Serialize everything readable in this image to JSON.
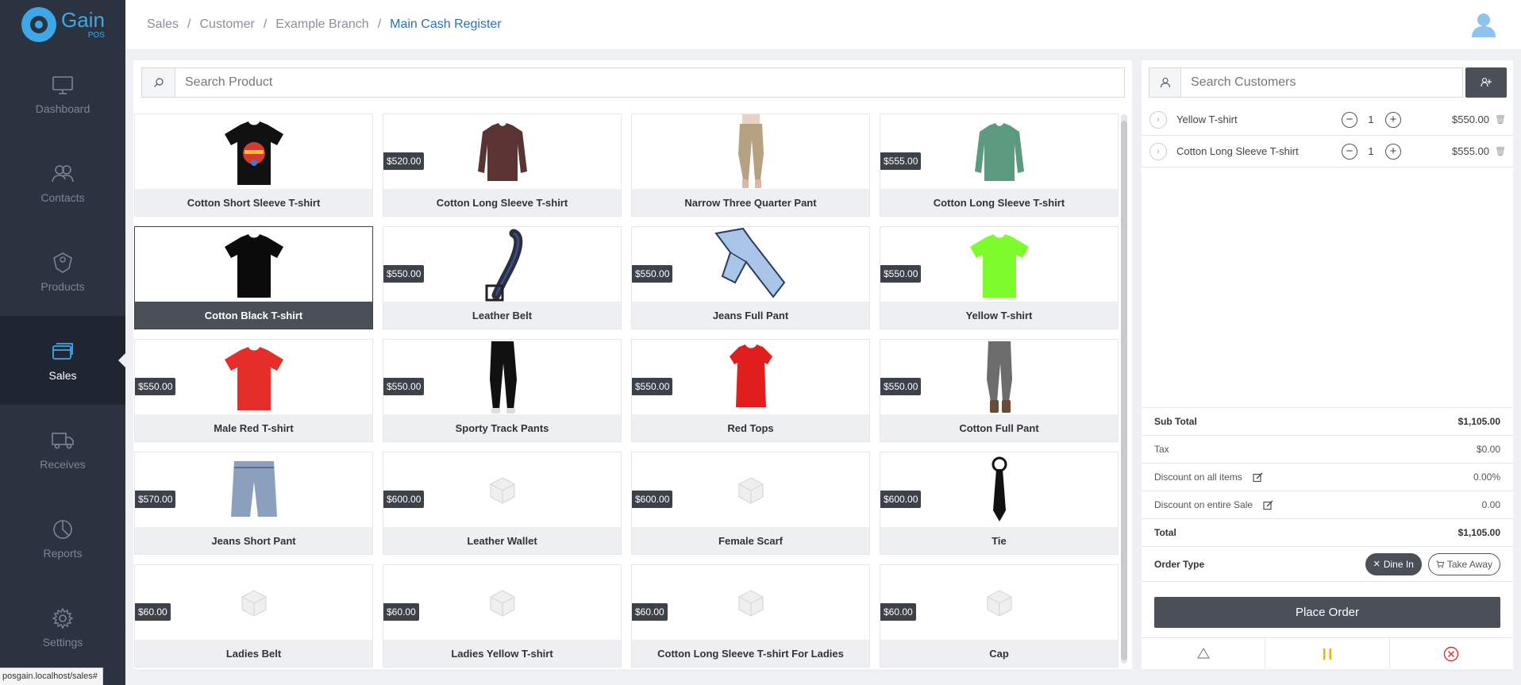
{
  "app": {
    "name": "Gain",
    "sub": "POS"
  },
  "nav": [
    {
      "label": "Dashboard",
      "icon": "monitor-icon"
    },
    {
      "label": "Contacts",
      "icon": "users-icon"
    },
    {
      "label": "Products",
      "icon": "cube-icon"
    },
    {
      "label": "Sales",
      "icon": "cards-icon",
      "active": true
    },
    {
      "label": "Receives",
      "icon": "truck-icon"
    },
    {
      "label": "Reports",
      "icon": "pie-chart-icon"
    },
    {
      "label": "Settings",
      "icon": "gear-icon"
    }
  ],
  "breadcrumb": [
    "Sales",
    "Customer",
    "Example Branch",
    "Main Cash Register"
  ],
  "search": {
    "placeholder": "Search Product"
  },
  "products": [
    {
      "name": "Cotton Short Sleeve T-shirt",
      "price": "",
      "img": "black-tshirt-print"
    },
    {
      "name": "Cotton Long Sleeve T-shirt",
      "price": "$520.00",
      "img": "longsleeve-maroon"
    },
    {
      "name": "Narrow Three Quarter Pant",
      "price": "",
      "img": "pants-beige"
    },
    {
      "name": "Cotton Long Sleeve T-shirt",
      "price": "$555.00",
      "img": "longsleeve-green"
    },
    {
      "name": "Cotton Black T-shirt",
      "price": "",
      "img": "tshirt-black",
      "selected": true
    },
    {
      "name": "Leather Belt",
      "price": "$550.00",
      "img": "belt"
    },
    {
      "name": "Jeans Full Pant",
      "price": "$550.00",
      "img": "jeans-light"
    },
    {
      "name": "Yellow T-shirt",
      "price": "$550.00",
      "img": "tshirt-lime"
    },
    {
      "name": "Male Red T-shirt",
      "price": "$550.00",
      "img": "tshirt-red"
    },
    {
      "name": "Sporty Track Pants",
      "price": "$550.00",
      "img": "pants-black"
    },
    {
      "name": "Red Tops",
      "price": "$550.00",
      "img": "tshirt-red-tops"
    },
    {
      "name": "Cotton Full Pant",
      "price": "$550.00",
      "img": "pants-grey"
    },
    {
      "name": "Jeans Short Pant",
      "price": "$570.00",
      "img": "shorts-jeans"
    },
    {
      "name": "Leather Wallet",
      "price": "$600.00",
      "img": "placeholder"
    },
    {
      "name": "Female Scarf",
      "price": "$600.00",
      "img": "placeholder"
    },
    {
      "name": "Tie",
      "price": "$600.00",
      "img": "tie"
    },
    {
      "name": "Ladies Belt",
      "price": "$60.00",
      "img": "placeholder"
    },
    {
      "name": "Ladies Yellow T-shirt",
      "price": "$60.00",
      "img": "placeholder"
    },
    {
      "name": "Cotton Long Sleeve T-shirt For Ladies",
      "price": "$60.00",
      "img": "placeholder"
    },
    {
      "name": "Cap",
      "price": "$60.00",
      "img": "placeholder"
    }
  ],
  "customer": {
    "placeholder": "Search Customers"
  },
  "cart": [
    {
      "name": "Yellow T-shirt",
      "qty": "1",
      "price": "$550.00"
    },
    {
      "name": "Cotton Long Sleeve T-shirt",
      "qty": "1",
      "price": "$555.00"
    }
  ],
  "summary": {
    "subtotal_label": "Sub Total",
    "subtotal": "$1,105.00",
    "tax_label": "Tax",
    "tax": "$0.00",
    "disc_items_label": "Discount on all items",
    "disc_items": "0.00%",
    "disc_sale_label": "Discount on entire Sale",
    "disc_sale": "0.00",
    "total_label": "Total",
    "total": "$1,105.00"
  },
  "order_type": {
    "label": "Order Type",
    "dine_in": "Dine In",
    "take_away": "Take Away"
  },
  "place_order": "Place Order",
  "status_url": "posgain.localhost/sales#"
}
